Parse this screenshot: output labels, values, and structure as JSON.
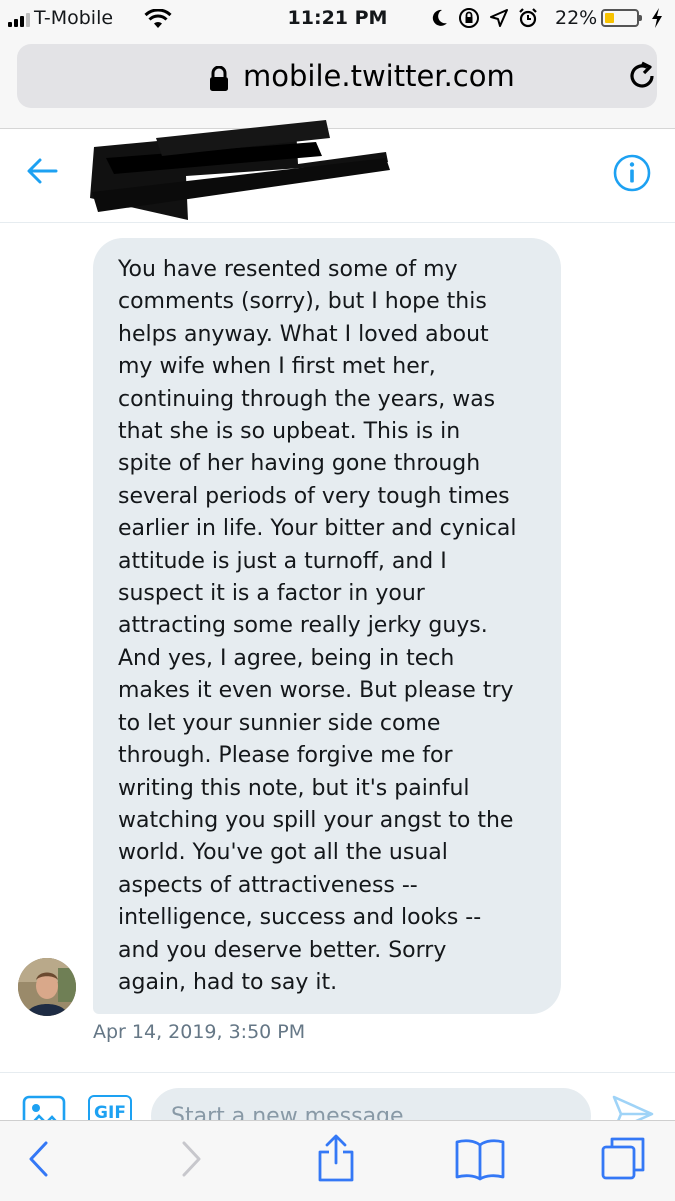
{
  "status_bar": {
    "carrier": "T-Mobile",
    "time": "11:21 PM",
    "battery_percent": "22%",
    "battery_level": 0.22,
    "icons": [
      "signal-icon",
      "wifi-icon",
      "moon-icon",
      "orientation-lock-icon",
      "location-icon",
      "alarm-icon",
      "battery-icon",
      "charging-bolt-icon"
    ]
  },
  "browser": {
    "url": "mobile.twitter.com",
    "icons": [
      "lock-icon",
      "reload-icon"
    ]
  },
  "conversation": {
    "icons": [
      "back-arrow-icon",
      "info-icon"
    ],
    "message": {
      "text": "You have resented some of my\ncomments (sorry), but I hope this\nhelps anyway. What I loved about\nmy wife when I first met her,\ncontinuing through the years, was\nthat she is so upbeat. This is in\nspite of her having gone through\nseveral periods of very tough times\nearlier in life. Your bitter and cynical\nattitude is just a turnoff, and I\nsuspect it is a factor in your\nattracting some really jerky guys.\nAnd yes, I agree, being in tech\nmakes it even worse. But please try\nto let your sunnier side come\nthrough. Please forgive me for\nwriting this note, but it's painful\nwatching you spill your angst to the\nworld. You've got all the usual\naspects of attractiveness --\nintelligence, success and looks --\nand you deserve better. Sorry\nagain, had to say it.",
      "timestamp": "Apr 14, 2019, 3:50 PM"
    }
  },
  "composer": {
    "gif_label": "GIF",
    "placeholder": "Start a new message",
    "value": ""
  },
  "colors": {
    "accent": "#1da1f2",
    "bubble": "#e6ecf0",
    "safari_blue": "#3478f6"
  }
}
